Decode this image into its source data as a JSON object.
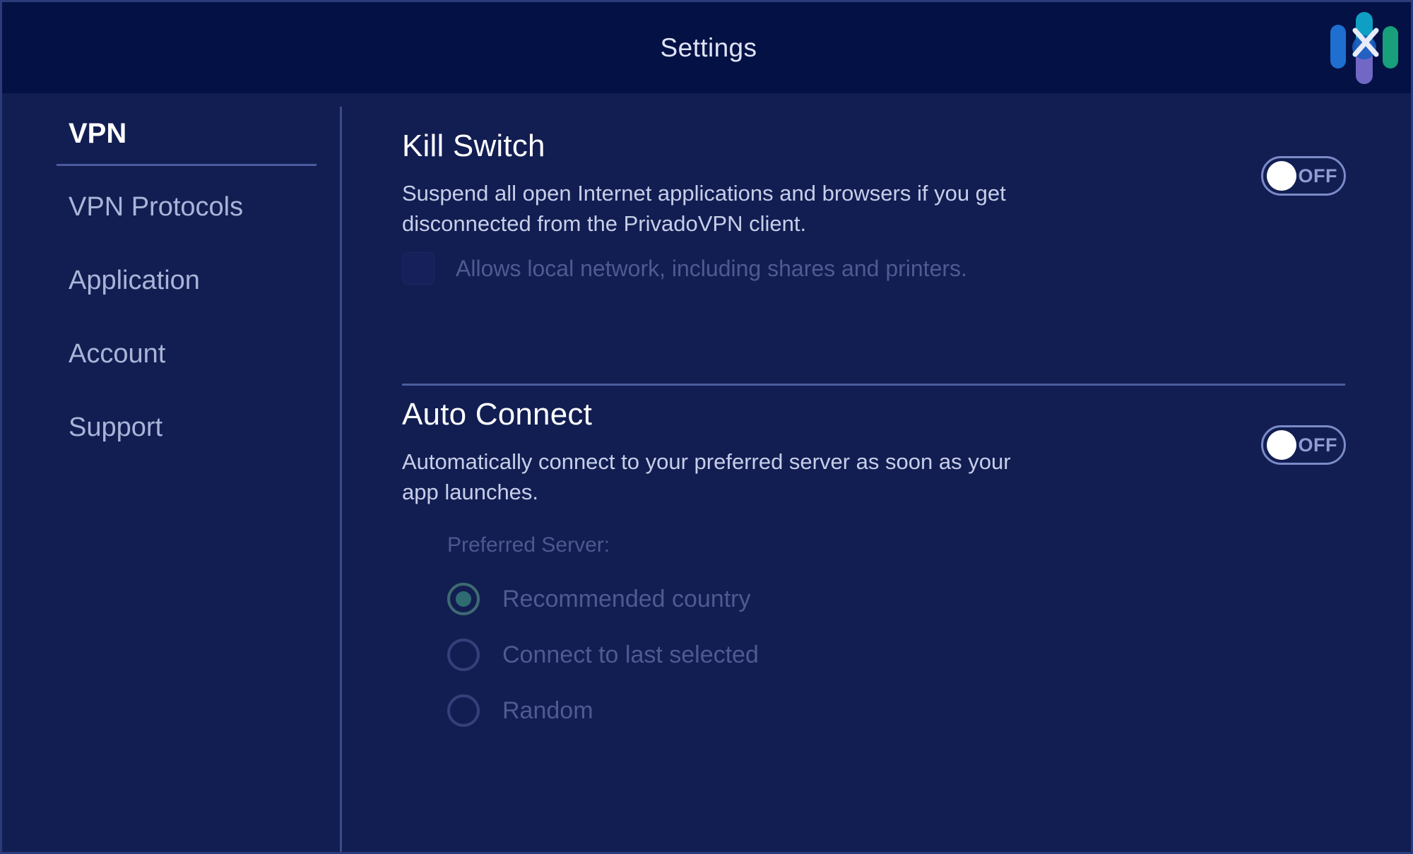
{
  "window": {
    "title": "Settings",
    "logo_icon": "privadovpn-logo-icon",
    "background_color": "#121e52",
    "titlebar_color": "#041144",
    "accent_color": "#2f6c72"
  },
  "sidebar": {
    "items": [
      {
        "label": "VPN",
        "active": true
      },
      {
        "label": "VPN Protocols",
        "active": false
      },
      {
        "label": "Application",
        "active": false
      },
      {
        "label": "Account",
        "active": false
      },
      {
        "label": "Support",
        "active": false
      }
    ]
  },
  "settings": {
    "kill_switch": {
      "title": "Kill Switch",
      "description": "Suspend all open Internet applications and browsers if you get disconnected from the PrivadoVPN client.",
      "toggle_label": "OFF",
      "toggle_state": "off",
      "local_network_label": "Allows local network, including shares and printers.",
      "local_network_checked": false
    },
    "auto_connect": {
      "title": "Auto Connect",
      "description": "Automatically connect to your preferred server as soon as your app launches.",
      "toggle_label": "OFF",
      "toggle_state": "off",
      "preferred_server_label": "Preferred Server:",
      "options": [
        {
          "label": "Recommended country",
          "selected": true
        },
        {
          "label": "Connect to last selected",
          "selected": false
        },
        {
          "label": "Random",
          "selected": false
        }
      ]
    }
  }
}
